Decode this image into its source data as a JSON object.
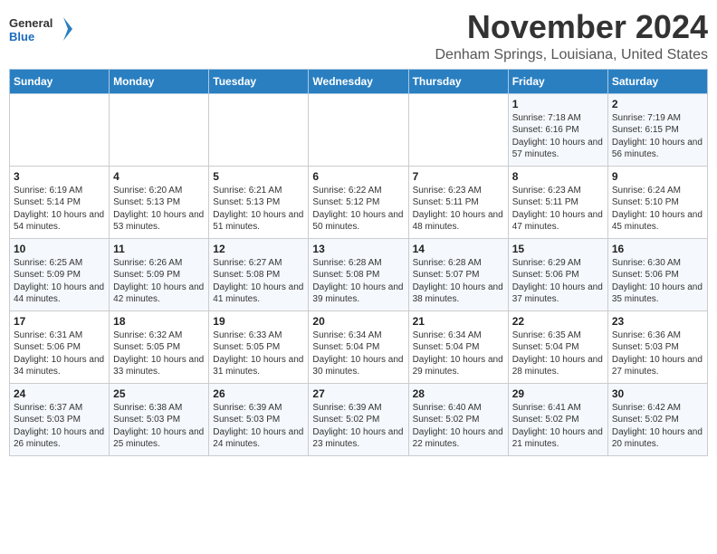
{
  "header": {
    "logo_line1": "General",
    "logo_line2": "Blue",
    "month": "November 2024",
    "location": "Denham Springs, Louisiana, United States"
  },
  "days_of_week": [
    "Sunday",
    "Monday",
    "Tuesday",
    "Wednesday",
    "Thursday",
    "Friday",
    "Saturday"
  ],
  "weeks": [
    [
      {
        "day": "",
        "info": ""
      },
      {
        "day": "",
        "info": ""
      },
      {
        "day": "",
        "info": ""
      },
      {
        "day": "",
        "info": ""
      },
      {
        "day": "",
        "info": ""
      },
      {
        "day": "1",
        "info": "Sunrise: 7:18 AM\nSunset: 6:16 PM\nDaylight: 10 hours and 57 minutes."
      },
      {
        "day": "2",
        "info": "Sunrise: 7:19 AM\nSunset: 6:15 PM\nDaylight: 10 hours and 56 minutes."
      }
    ],
    [
      {
        "day": "3",
        "info": "Sunrise: 6:19 AM\nSunset: 5:14 PM\nDaylight: 10 hours and 54 minutes."
      },
      {
        "day": "4",
        "info": "Sunrise: 6:20 AM\nSunset: 5:13 PM\nDaylight: 10 hours and 53 minutes."
      },
      {
        "day": "5",
        "info": "Sunrise: 6:21 AM\nSunset: 5:13 PM\nDaylight: 10 hours and 51 minutes."
      },
      {
        "day": "6",
        "info": "Sunrise: 6:22 AM\nSunset: 5:12 PM\nDaylight: 10 hours and 50 minutes."
      },
      {
        "day": "7",
        "info": "Sunrise: 6:23 AM\nSunset: 5:11 PM\nDaylight: 10 hours and 48 minutes."
      },
      {
        "day": "8",
        "info": "Sunrise: 6:23 AM\nSunset: 5:11 PM\nDaylight: 10 hours and 47 minutes."
      },
      {
        "day": "9",
        "info": "Sunrise: 6:24 AM\nSunset: 5:10 PM\nDaylight: 10 hours and 45 minutes."
      }
    ],
    [
      {
        "day": "10",
        "info": "Sunrise: 6:25 AM\nSunset: 5:09 PM\nDaylight: 10 hours and 44 minutes."
      },
      {
        "day": "11",
        "info": "Sunrise: 6:26 AM\nSunset: 5:09 PM\nDaylight: 10 hours and 42 minutes."
      },
      {
        "day": "12",
        "info": "Sunrise: 6:27 AM\nSunset: 5:08 PM\nDaylight: 10 hours and 41 minutes."
      },
      {
        "day": "13",
        "info": "Sunrise: 6:28 AM\nSunset: 5:08 PM\nDaylight: 10 hours and 39 minutes."
      },
      {
        "day": "14",
        "info": "Sunrise: 6:28 AM\nSunset: 5:07 PM\nDaylight: 10 hours and 38 minutes."
      },
      {
        "day": "15",
        "info": "Sunrise: 6:29 AM\nSunset: 5:06 PM\nDaylight: 10 hours and 37 minutes."
      },
      {
        "day": "16",
        "info": "Sunrise: 6:30 AM\nSunset: 5:06 PM\nDaylight: 10 hours and 35 minutes."
      }
    ],
    [
      {
        "day": "17",
        "info": "Sunrise: 6:31 AM\nSunset: 5:06 PM\nDaylight: 10 hours and 34 minutes."
      },
      {
        "day": "18",
        "info": "Sunrise: 6:32 AM\nSunset: 5:05 PM\nDaylight: 10 hours and 33 minutes."
      },
      {
        "day": "19",
        "info": "Sunrise: 6:33 AM\nSunset: 5:05 PM\nDaylight: 10 hours and 31 minutes."
      },
      {
        "day": "20",
        "info": "Sunrise: 6:34 AM\nSunset: 5:04 PM\nDaylight: 10 hours and 30 minutes."
      },
      {
        "day": "21",
        "info": "Sunrise: 6:34 AM\nSunset: 5:04 PM\nDaylight: 10 hours and 29 minutes."
      },
      {
        "day": "22",
        "info": "Sunrise: 6:35 AM\nSunset: 5:04 PM\nDaylight: 10 hours and 28 minutes."
      },
      {
        "day": "23",
        "info": "Sunrise: 6:36 AM\nSunset: 5:03 PM\nDaylight: 10 hours and 27 minutes."
      }
    ],
    [
      {
        "day": "24",
        "info": "Sunrise: 6:37 AM\nSunset: 5:03 PM\nDaylight: 10 hours and 26 minutes."
      },
      {
        "day": "25",
        "info": "Sunrise: 6:38 AM\nSunset: 5:03 PM\nDaylight: 10 hours and 25 minutes."
      },
      {
        "day": "26",
        "info": "Sunrise: 6:39 AM\nSunset: 5:03 PM\nDaylight: 10 hours and 24 minutes."
      },
      {
        "day": "27",
        "info": "Sunrise: 6:39 AM\nSunset: 5:02 PM\nDaylight: 10 hours and 23 minutes."
      },
      {
        "day": "28",
        "info": "Sunrise: 6:40 AM\nSunset: 5:02 PM\nDaylight: 10 hours and 22 minutes."
      },
      {
        "day": "29",
        "info": "Sunrise: 6:41 AM\nSunset: 5:02 PM\nDaylight: 10 hours and 21 minutes."
      },
      {
        "day": "30",
        "info": "Sunrise: 6:42 AM\nSunset: 5:02 PM\nDaylight: 10 hours and 20 minutes."
      }
    ]
  ]
}
